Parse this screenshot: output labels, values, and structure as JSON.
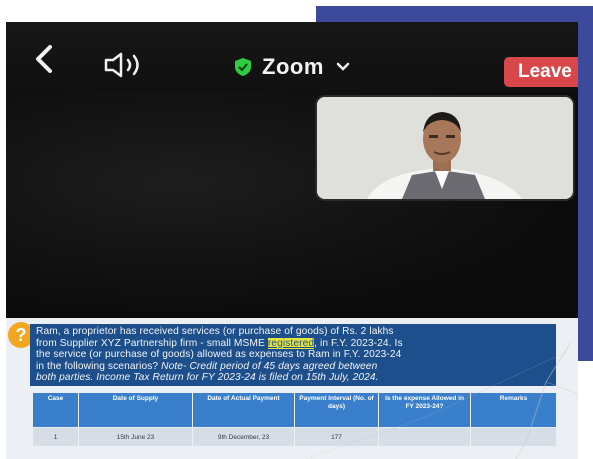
{
  "header": {
    "app_title": "Zoom",
    "leave_label": "Leave",
    "back_icon": "chevron-left-icon",
    "audio_icon": "speaker-icon",
    "security_icon": "shield-icon",
    "colors": {
      "leave": "#d8474a",
      "shield": "#2ecc40",
      "slide_box": "#1c4f8c",
      "table_header": "#3a7fcb"
    }
  },
  "slide": {
    "question_icon": "?",
    "question": {
      "line1": "Ram, a proprietor has received services (or purchase of goods) of Rs. 2 lakhs",
      "line2_a": "from Supplier XYZ Partnership firm - small MSME ",
      "line2_highlight": "registered",
      "line2_b": ", in F.Y. 2023-24. Is",
      "line3": "the service (or purchase of goods) allowed as expenses to Ram in F.Y. 2023-24",
      "line4_a": "in the following scenarios? ",
      "line4_b": "Note- Credit period of 45 days agreed between",
      "line5": "both parties. Income Tax Return for FY 2023-24 is filed on 15th July, 2024."
    },
    "table": {
      "headers": [
        "Case",
        "Date of Supply",
        "Date of Actual Payment",
        "Payment Interval (No. of days)",
        "Is the expense Allowed in FY 2023-24?",
        "Remarks"
      ],
      "rows": [
        [
          "1",
          "15th June 23",
          "9th December, 23",
          "177",
          "",
          ""
        ]
      ]
    }
  }
}
